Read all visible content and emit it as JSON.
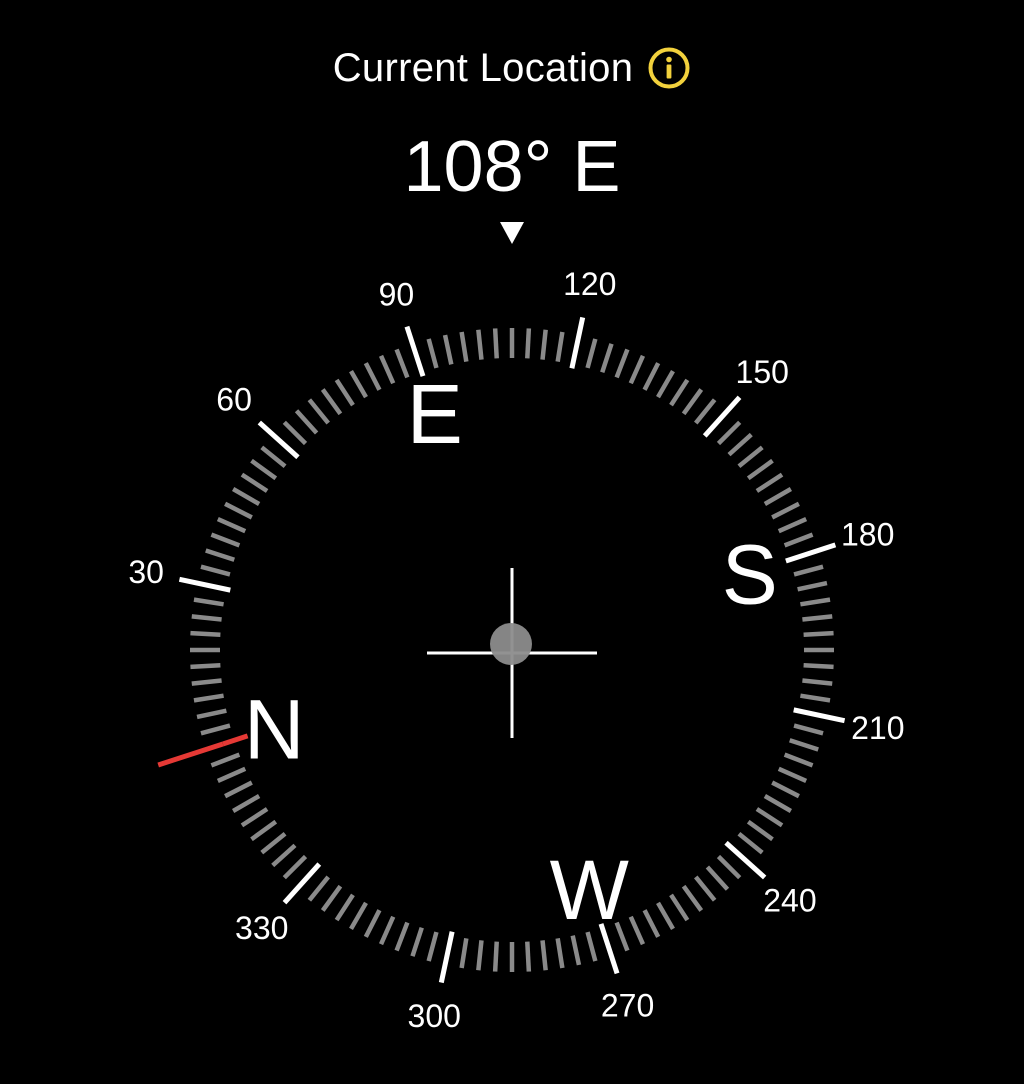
{
  "header": {
    "title": "Current Location",
    "info_icon": "info-icon",
    "info_color": "#f2d13c"
  },
  "heading": {
    "degrees": 108,
    "text": "108° E"
  },
  "target_bearing_degrees": 0,
  "compass": {
    "cardinals": [
      {
        "label": "N",
        "deg": 0
      },
      {
        "label": "E",
        "deg": 90
      },
      {
        "label": "S",
        "deg": 180
      },
      {
        "label": "W",
        "deg": 270
      }
    ],
    "degree_labels": [
      {
        "text": "30",
        "deg": 30
      },
      {
        "text": "60",
        "deg": 60
      },
      {
        "text": "90",
        "deg": 90
      },
      {
        "text": "120",
        "deg": 120
      },
      {
        "text": "150",
        "deg": 150
      },
      {
        "text": "180",
        "deg": 180
      },
      {
        "text": "210",
        "deg": 210
      },
      {
        "text": "240",
        "deg": 240
      },
      {
        "text": "270",
        "deg": 270
      },
      {
        "text": "300",
        "deg": 300
      },
      {
        "text": "330",
        "deg": 330
      }
    ],
    "colors": {
      "major_tick": "#ffffff",
      "minor_tick": "#8a8a8a",
      "target_marker": "#e53935",
      "center_dot": "#8c8c8c"
    }
  }
}
